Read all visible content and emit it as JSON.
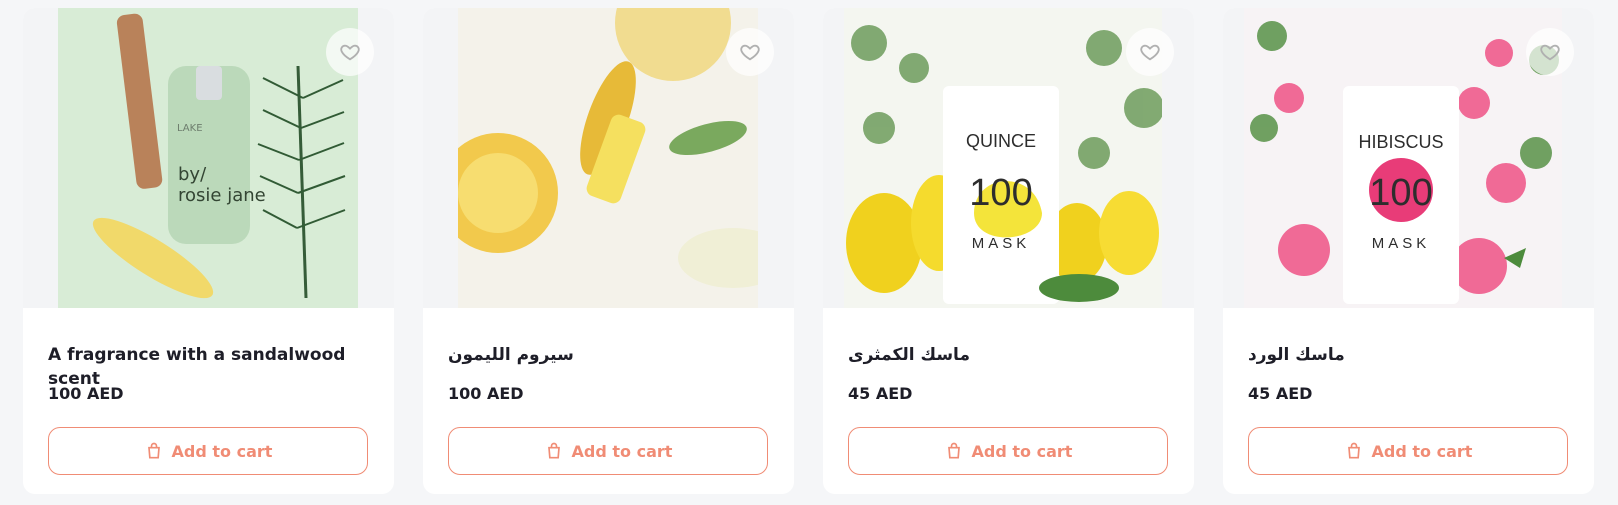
{
  "theme": {
    "accent": "#f08c75",
    "text": "#1e1e28",
    "page_bg": "#f5f6f8",
    "card_bg": "#ffffff"
  },
  "icons": {
    "wishlist": "heart-icon",
    "cart": "shopping-bag-icon"
  },
  "products": [
    {
      "title": "A fragrance with a sandalwood scent",
      "price": "100 AED",
      "button": "Add to cart",
      "image_text": [
        "by/",
        "rosie jane",
        "LAKE"
      ]
    },
    {
      "title": "سيروم الليمون",
      "price": "100 AED",
      "button": "Add to cart"
    },
    {
      "title": "ماسك الكمثرى",
      "price": "45 AED",
      "button": "Add to cart",
      "image_text": [
        "QUINCE",
        "100",
        "MASK"
      ]
    },
    {
      "title": "ماسك الورد",
      "price": "45 AED",
      "button": "Add to cart",
      "image_text": [
        "HIBISCUS",
        "100",
        "MASK"
      ]
    }
  ]
}
